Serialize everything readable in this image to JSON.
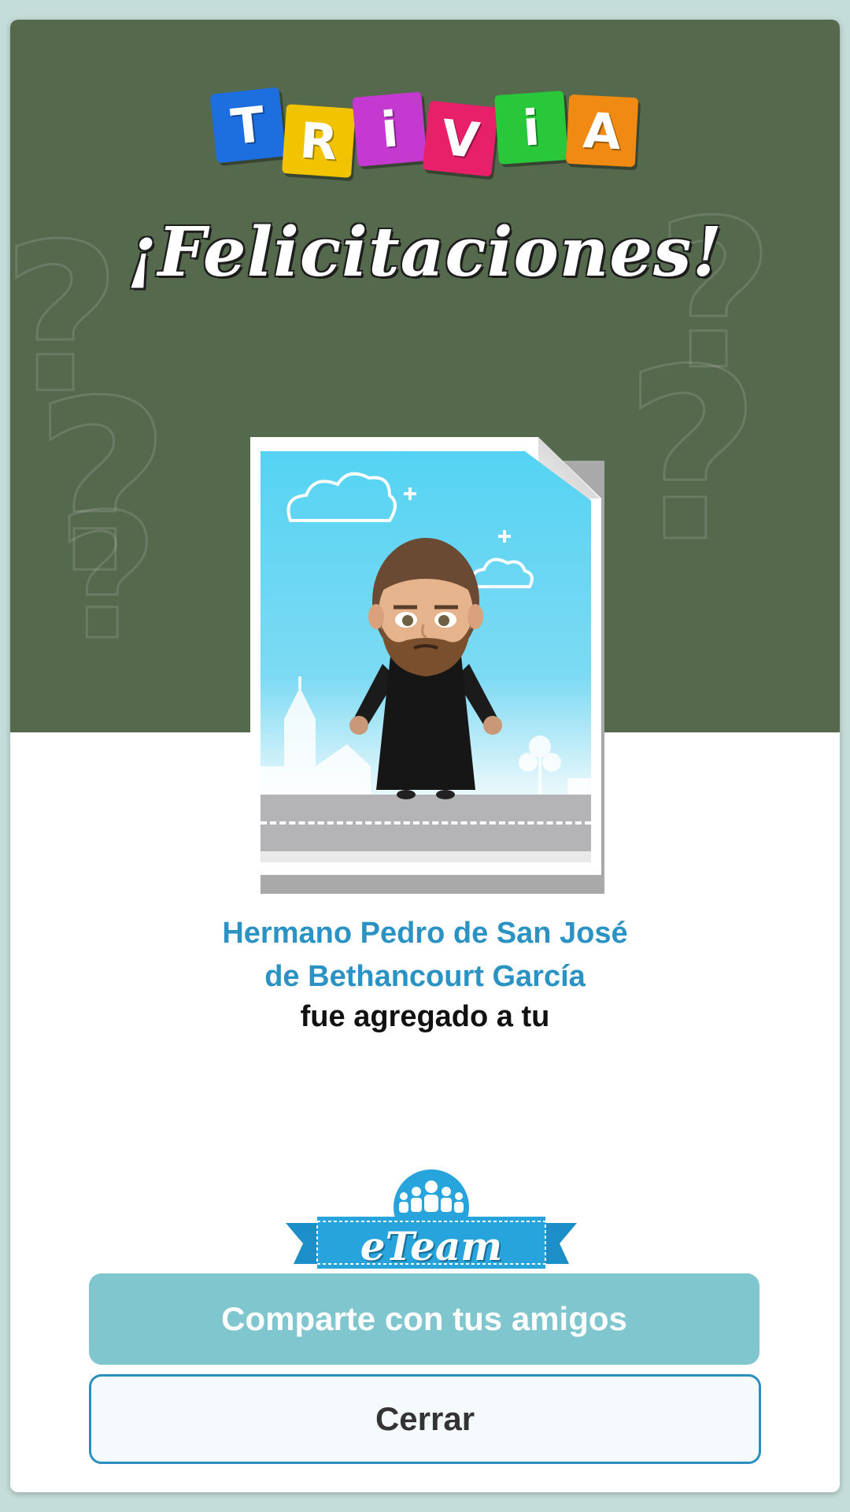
{
  "logo": {
    "letters": [
      {
        "char": "T",
        "color": "#1d6fe0"
      },
      {
        "char": "R",
        "color": "#f2c300"
      },
      {
        "char": "i",
        "color": "#c43ad0"
      },
      {
        "char": "V",
        "color": "#e8206a"
      },
      {
        "char": "i",
        "color": "#28c83a"
      },
      {
        "char": "A",
        "color": "#f08a12"
      }
    ]
  },
  "header": {
    "title": "¡Felicitaciones!"
  },
  "card": {
    "character_name_line1": "Hermano Pedro de San José",
    "character_name_line2": "de Bethancourt García",
    "message": "fue agregado a tu"
  },
  "badge": {
    "label": "eTeam",
    "icon": "group-icon"
  },
  "actions": {
    "share_label": "Comparte con tus amigos",
    "close_label": "Cerrar"
  },
  "colors": {
    "board": "#55694d",
    "accent_blue": "#2a93c4",
    "share_button": "#7fc6cf",
    "close_border": "#2a8fc0"
  }
}
